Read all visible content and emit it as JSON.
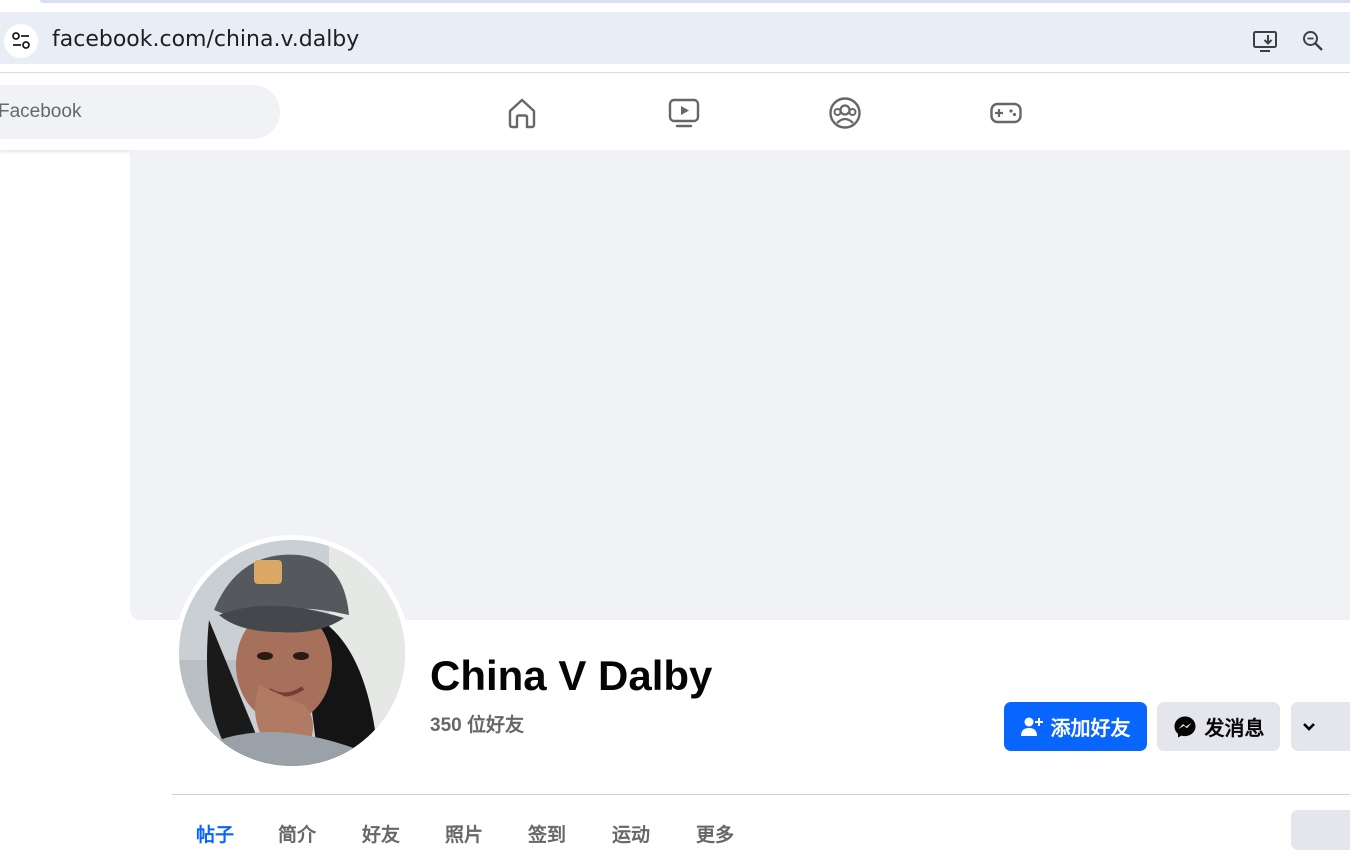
{
  "browser": {
    "url": "facebook.com/china.v.dalby"
  },
  "fbnav": {
    "search_placeholder": "Facebook",
    "icons": [
      "home-icon",
      "video-icon",
      "groups-icon",
      "gaming-icon"
    ]
  },
  "profile": {
    "name": "China V Dalby",
    "friends": "350 位好友",
    "add_friend_label": "添加好友",
    "message_label": "发消息"
  },
  "tabs": [
    {
      "label": "帖子",
      "active": true
    },
    {
      "label": "简介",
      "active": false
    },
    {
      "label": "好友",
      "active": false
    },
    {
      "label": "照片",
      "active": false
    },
    {
      "label": "签到",
      "active": false
    },
    {
      "label": "运动",
      "active": false
    },
    {
      "label": "更多",
      "active": false
    }
  ],
  "colors": {
    "accent": "#0866ff",
    "cover_bg": "#f0f2f5",
    "button_gray": "#e4e6eb"
  }
}
